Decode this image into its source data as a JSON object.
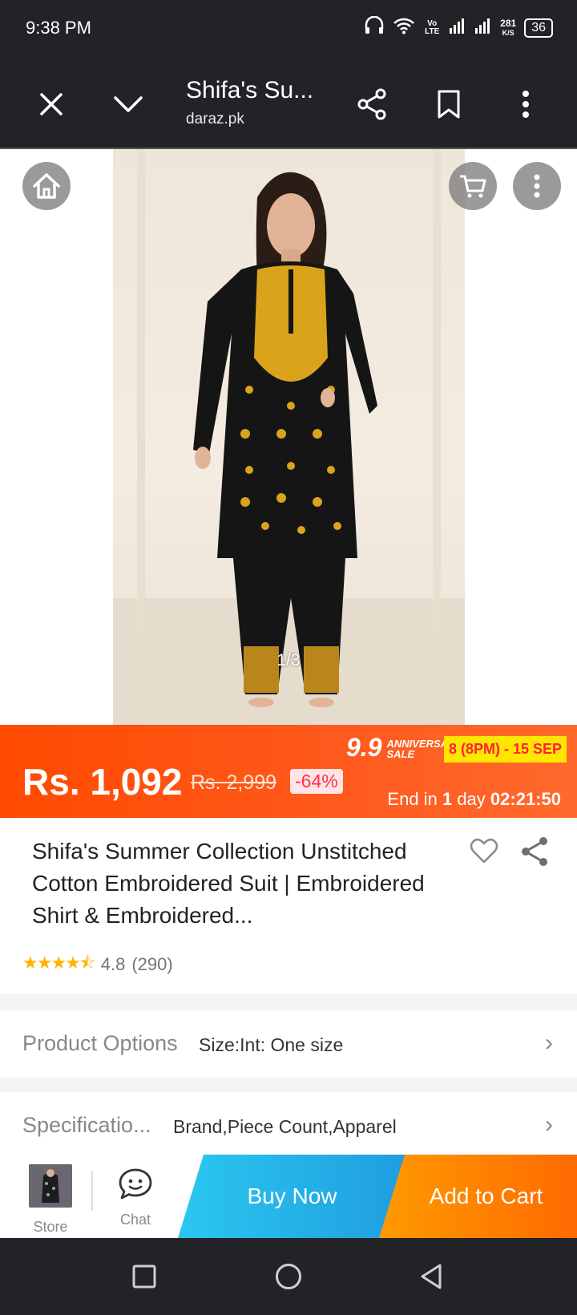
{
  "status_bar": {
    "time": "9:38 PM",
    "net_speed_top": "281",
    "net_speed_unit": "K/S",
    "battery": "36",
    "volte_label": "Vo LTE",
    "icons": [
      "headphones-icon",
      "wifi-icon",
      "signal-icon",
      "signal-icon"
    ]
  },
  "browser": {
    "title": "Shifa's Su...",
    "url": "daraz.pk",
    "icons": [
      "close-icon",
      "chevron-down-icon",
      "share-icon",
      "bookmark-icon",
      "more-vert-icon"
    ]
  },
  "gallery": {
    "counter": "1/3",
    "icons": [
      "home-icon",
      "cart-icon",
      "more-vert-icon"
    ]
  },
  "price": {
    "current": "Rs. 1,092",
    "original": "Rs. 2,999",
    "discount": "-64%",
    "sale_number": "9.9",
    "sale_name_line1": "ANNIVERSARY",
    "sale_name_line2": "SALE",
    "sale_dates": "8 (8PM) - 15 SEP",
    "end_prefix": "End in",
    "end_days": "1",
    "end_unit": "day",
    "end_time": "02:21:50"
  },
  "product": {
    "title": "Shifa's Summer Collection Unstitched Cotton Embroidered Suit | Embroidered Shirt & Embroidered...",
    "rating_value": "4.8",
    "rating_count": "(290)",
    "stars": 4.5
  },
  "options": {
    "label": "Product Options",
    "value": "Size:Int: One size"
  },
  "specs": {
    "label": "Specificatio...",
    "value": "Brand,Piece Count,Apparel"
  },
  "actions": {
    "store_label": "Store",
    "chat_label": "Chat",
    "buy_now": "Buy Now",
    "add_to_cart": "Add to Cart"
  },
  "colors": {
    "price_bar": "#ff4a00",
    "buy_now": "#1f9ee0",
    "add_to_cart": "#ff7a00",
    "sale_badge": "#ffe600",
    "star": "#ffb400"
  }
}
